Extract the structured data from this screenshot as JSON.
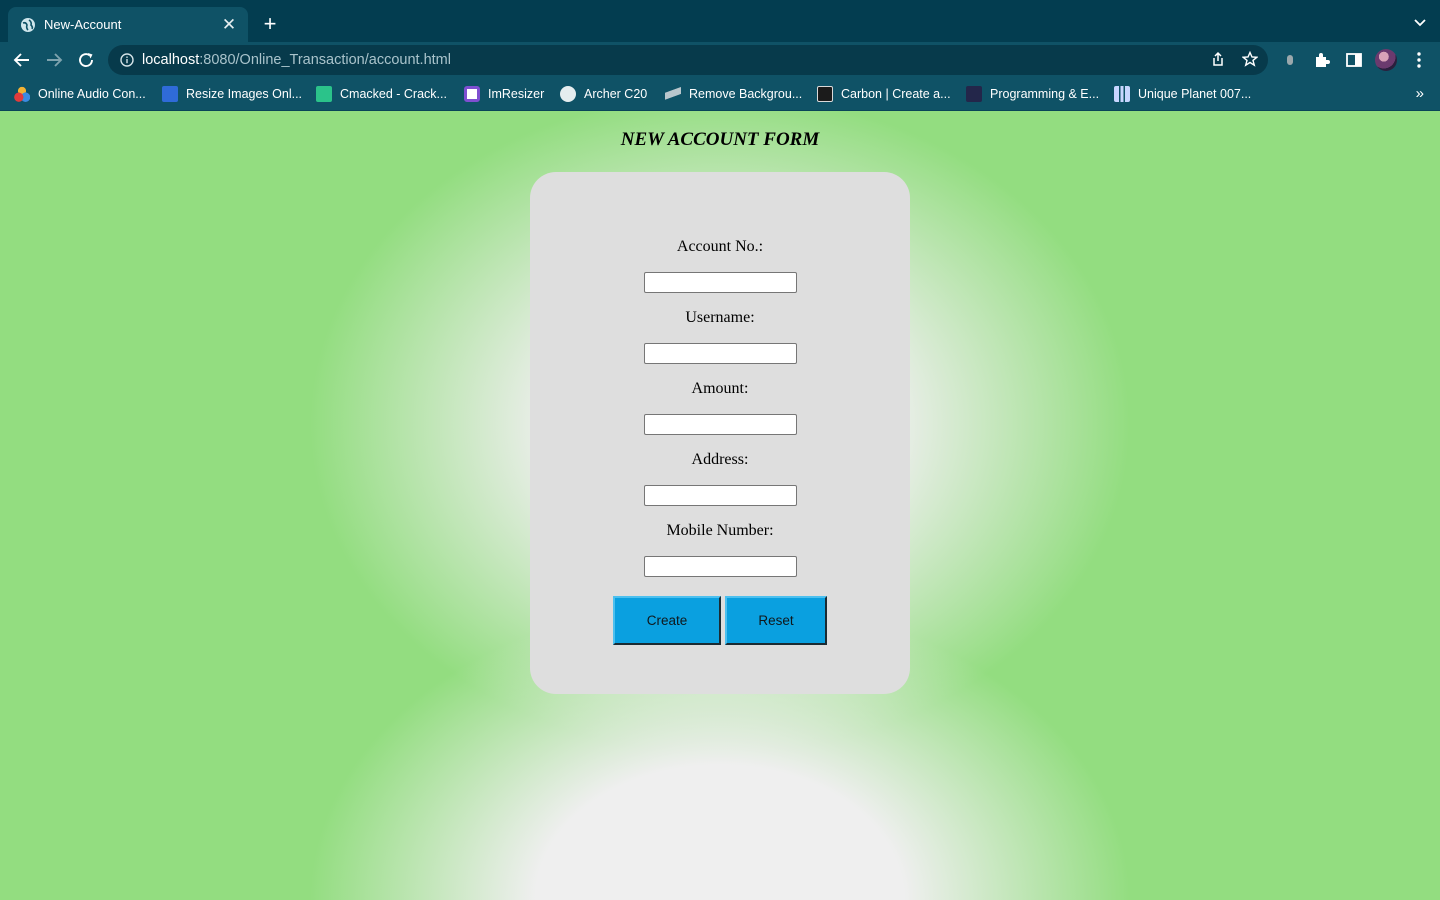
{
  "browser": {
    "tab": {
      "title": "New-Account",
      "favicon": "globe-icon",
      "close_glyph": "✕"
    },
    "new_tab_glyph": "+",
    "address": {
      "host": "localhost",
      "rest": ":8080/Online_Transaction/account.html"
    },
    "bookmarks": [
      {
        "label": "Online Audio Con...",
        "icon": "online-audio-converter-icon",
        "color": "#f2b233"
      },
      {
        "label": "Resize Images Onl...",
        "icon": "resize-images-icon",
        "color": "#2f6bd8"
      },
      {
        "label": "Cmacked - Crack...",
        "icon": "cmacked-icon",
        "color": "#2bc38a"
      },
      {
        "label": "ImResizer",
        "icon": "imresizer-icon",
        "color": "#7f4fd1"
      },
      {
        "label": "Archer C20",
        "icon": "globe-icon",
        "color": "#e5edef"
      },
      {
        "label": "Remove Backgrou...",
        "icon": "remove-bg-icon",
        "color": "#b9c6cc"
      },
      {
        "label": "Carbon | Create a...",
        "icon": "carbon-icon",
        "color": "#1b1b1b"
      },
      {
        "label": "Programming & E...",
        "icon": "programming-icon",
        "color": "#23264a"
      },
      {
        "label": "Unique Planet 007...",
        "icon": "unique-planet-icon",
        "color": "#c8d6ff"
      }
    ],
    "bookmarks_more": "»"
  },
  "page": {
    "title": "NEW ACCOUNT FORM",
    "fields": [
      {
        "label": "Account No.:",
        "value": ""
      },
      {
        "label": "Username:",
        "value": ""
      },
      {
        "label": "Amount:",
        "value": ""
      },
      {
        "label": "Address:",
        "value": ""
      },
      {
        "label": "Mobile Number:",
        "value": ""
      }
    ],
    "create_label": "Create",
    "reset_label": "Reset"
  },
  "colors": {
    "page_background": "#93dd80",
    "form_card": "#dedede",
    "button": "#0aa0e0",
    "chrome": "#0f5266"
  }
}
